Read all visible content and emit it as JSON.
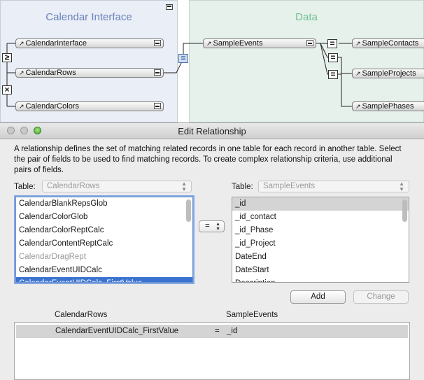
{
  "graph": {
    "groups": [
      {
        "title": "Calendar Interface"
      },
      {
        "title": "Data"
      }
    ],
    "tables": [
      "CalendarInterface",
      "CalendarRows",
      "CalendarColors",
      "SampleEvents",
      "SampleContacts",
      "SampleProjects",
      "SamplePhases"
    ],
    "ops": {
      "gte": "≥",
      "times": "×",
      "eq": "="
    }
  },
  "dialog": {
    "title": "Edit Relationship",
    "description": "A relationship defines the set of matching related records in one table for each record in another table. Select the pair of fields to be used to find matching records. To create complex relationship criteria, use additional pairs of fields.",
    "left_table": {
      "label": "Table:",
      "value": "CalendarRows",
      "fields": [
        "CalendarBlankRepsGlob",
        "CalendarColorGlob",
        "CalendarColorReptCalc",
        "CalendarContentReptCalc",
        "CalendarDragRept",
        "CalendarEventUIDCalc",
        "CalendarEventUIDCalc_FirstValue"
      ]
    },
    "right_table": {
      "label": "Table:",
      "value": "SampleEvents",
      "fields": [
        "_id",
        "_id_contact",
        "_id_Phase",
        "_id_Project",
        "DateEnd",
        "DateStart",
        "Description"
      ]
    },
    "operator": "=",
    "buttons": {
      "add": "Add",
      "change": "Change"
    },
    "criteria": {
      "left_header": "CalendarRows",
      "right_header": "SampleEvents",
      "rows": [
        {
          "left": "CalendarEventUIDCalc_FirstValue",
          "op": "=",
          "right": "_id"
        }
      ]
    }
  }
}
